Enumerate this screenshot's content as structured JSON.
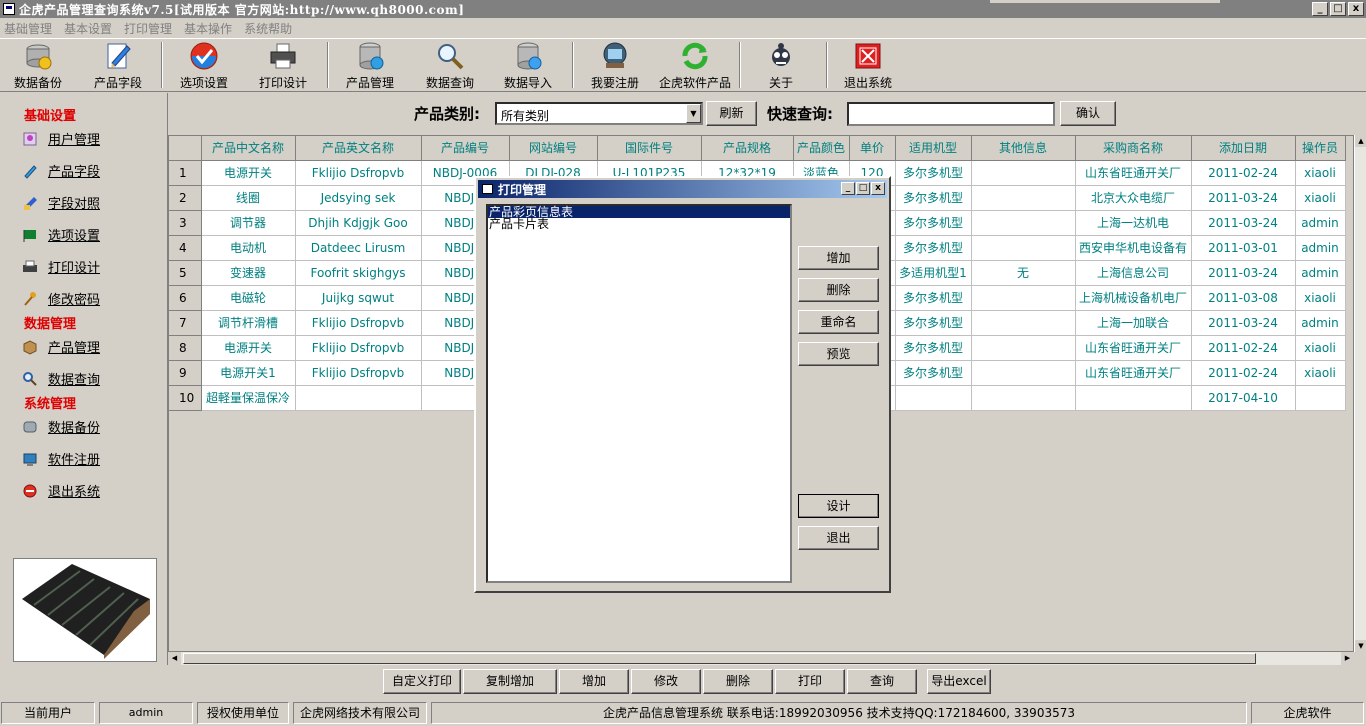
{
  "window": {
    "title": "企虎产品管理查询系统v7.5[试用版本 官方网站:http://www.qh8000.com]",
    "controls": [
      "_",
      "□",
      "x"
    ]
  },
  "menu": [
    "基础管理",
    "基本设置",
    "打印管理",
    "基本操作",
    "系统帮助"
  ],
  "toolbar": [
    {
      "label": "数据备份",
      "icon": "database-backup-icon"
    },
    {
      "label": "产品字段",
      "icon": "pen-icon"
    },
    {
      "label": "选项设置",
      "icon": "check-icon"
    },
    {
      "label": "打印设计",
      "icon": "printer-icon"
    },
    {
      "label": "产品管理",
      "icon": "database-icon"
    },
    {
      "label": "数据查询",
      "icon": "magnifier-icon"
    },
    {
      "label": "数据导入",
      "icon": "import-icon"
    },
    {
      "label": "我要注册",
      "icon": "register-icon"
    },
    {
      "label": "企虎软件产品",
      "icon": "refresh-icon"
    },
    {
      "label": "关于",
      "icon": "about-icon"
    },
    {
      "label": "退出系统",
      "icon": "exit-icon"
    }
  ],
  "sidebar": {
    "groups": [
      {
        "title": "基础设置",
        "items": [
          "用户管理",
          "产品字段",
          "字段对照",
          "选项设置",
          "打印设计",
          "修改密码"
        ]
      },
      {
        "title": "数据管理",
        "items": [
          "产品管理",
          "数据查询"
        ]
      },
      {
        "title": "系统管理",
        "items": [
          "数据备份",
          "软件注册",
          "退出系统"
        ]
      }
    ]
  },
  "filter": {
    "category_label": "产品类别:",
    "category_value": "所有类别",
    "refresh": "刷新",
    "quick_label": "快速查询:",
    "quick_value": "",
    "confirm": "确认"
  },
  "table": {
    "columns": [
      "产品中文名称",
      "产品英文名称",
      "产品编号",
      "网站编号",
      "国际件号",
      "产品规格",
      "产品颜色",
      "单价",
      "适用机型",
      "其他信息",
      "采购商名称",
      "添加日期",
      "操作员"
    ],
    "rows": [
      [
        "1",
        "电源开关",
        "Fklijio Dsfropvb",
        "NBDJ-0006",
        "DLDJ-028",
        "U-L101P235",
        "12*32*19",
        "淡蓝色",
        "120",
        "多尔多机型",
        "",
        "山东省旺通开关厂",
        "2011-02-24",
        "xiaoli"
      ],
      [
        "2",
        "线圈",
        "Jedsying sek",
        "NBDJ-0",
        "",
        "",
        "",
        "",
        "",
        "多尔多机型",
        "",
        "北京大众电缆厂",
        "2011-03-24",
        "xiaoli"
      ],
      [
        "3",
        "调节器",
        "Dhjih Kdjgjk Goo",
        "NBDJ-0",
        "",
        "",
        "",
        "",
        "",
        "多尔多机型",
        "",
        "上海一达机电",
        "2011-03-24",
        "admin"
      ],
      [
        "4",
        "电动机",
        "Datdeec Lirusm",
        "NBDJ-0",
        "",
        "",
        "",
        "",
        "",
        "多尔多机型",
        "",
        "西安申华机电设备有",
        "2011-03-01",
        "admin"
      ],
      [
        "5",
        "变速器",
        "Foofrit skighgys",
        "NBDJ-0",
        "",
        "",
        "",
        "",
        "",
        "多适用机型1",
        "无",
        "上海信息公司",
        "2011-03-24",
        "admin"
      ],
      [
        "6",
        "电磁轮",
        "Juijkg sqwut",
        "NBDJ-0",
        "",
        "",
        "",
        "",
        "",
        "多尔多机型",
        "",
        "上海机械设备机电厂",
        "2011-03-08",
        "xiaoli"
      ],
      [
        "7",
        "调节杆滑槽",
        "Fklijio Dsfropvb",
        "NBDJ-0",
        "",
        "",
        "",
        "",
        "",
        "多尔多机型",
        "",
        "上海一加联合",
        "2011-03-24",
        "admin"
      ],
      [
        "8",
        "电源开关",
        "Fklijio Dsfropvb",
        "NBDJ-0",
        "",
        "",
        "",
        "",
        "",
        "多尔多机型",
        "",
        "山东省旺通开关厂",
        "2011-02-24",
        "xiaoli"
      ],
      [
        "9",
        "电源开关1",
        "Fklijio Dsfropvb",
        "NBDJ-0",
        "",
        "",
        "",
        "",
        "",
        "多尔多机型",
        "",
        "山东省旺通开关厂",
        "2011-02-24",
        "xiaoli"
      ],
      [
        "10",
        "超軽量保温保冷",
        "",
        "",
        "",
        "",
        "",
        "",
        "",
        "",
        "",
        "",
        "2017-04-10",
        ""
      ]
    ]
  },
  "actions": [
    "自定义打印",
    "复制增加",
    "增加",
    "修改",
    "删除",
    "打印",
    "查询",
    "导出excel"
  ],
  "status": {
    "user_label": "当前用户",
    "user": "admin",
    "unit_label": "授权使用单位",
    "unit": "企虎网络技术有限公司",
    "info": "企虎产品信息管理系统   联系电话:18992030956   技术支持QQ:172184600, 33903573",
    "brand": "企虎软件"
  },
  "dialog": {
    "title": "打印管理",
    "list": [
      "产品彩页信息表",
      "产品卡片表"
    ],
    "selected_index": 0,
    "buttons": [
      "增加",
      "删除",
      "重命名",
      "预览"
    ],
    "design": "设计",
    "exit": "退出"
  }
}
